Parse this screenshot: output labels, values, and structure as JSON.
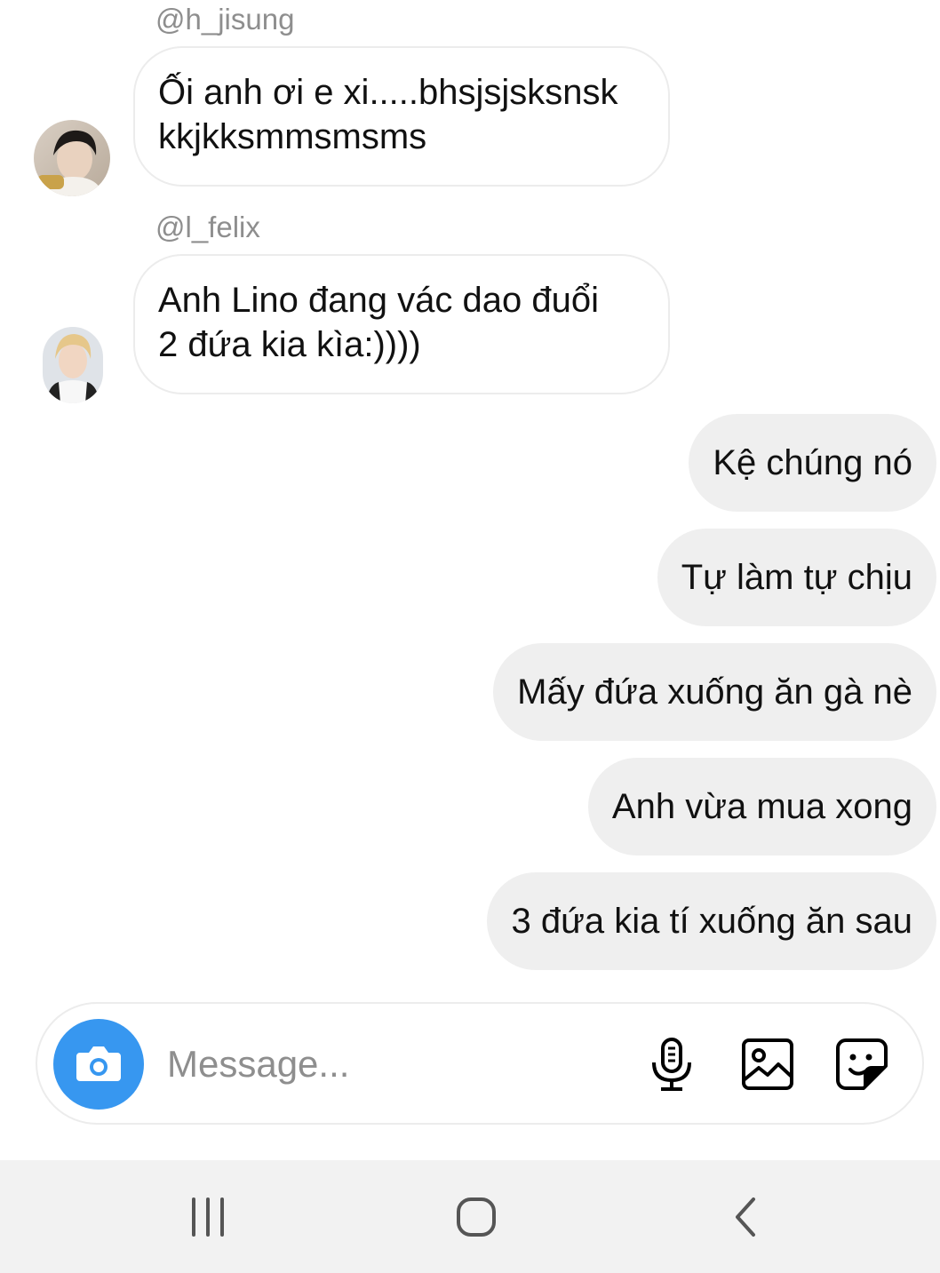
{
  "thread": {
    "incoming": [
      {
        "sender": "@h_jisung",
        "lines": [
          "Ối anh ơi e xi.....bhsjsjsksnsk",
          "kkjkksmmsmsms"
        ],
        "avatar": "user-avatar-photo"
      },
      {
        "sender": "@l_felix",
        "lines": [
          "Anh Lino đang vác dao đuổi",
          "2 đứa kia kìa:))))"
        ],
        "avatar": "user-avatar-photo"
      }
    ],
    "outgoing": [
      "Kệ chúng nó",
      "Tự làm tự chịu",
      "Mấy đứa xuống ăn gà nè",
      "Anh vừa mua xong",
      "3 đứa kia tí xuống ăn sau"
    ]
  },
  "composer": {
    "placeholder": "Message...",
    "camera_icon": "camera-icon",
    "mic_icon": "microphone-icon",
    "gallery_icon": "image-icon",
    "sticker_icon": "sticker-icon",
    "accent_color": "#3797f0"
  },
  "system_nav": {
    "recents_icon": "recents-icon",
    "home_icon": "home-icon",
    "back_icon": "back-icon"
  }
}
